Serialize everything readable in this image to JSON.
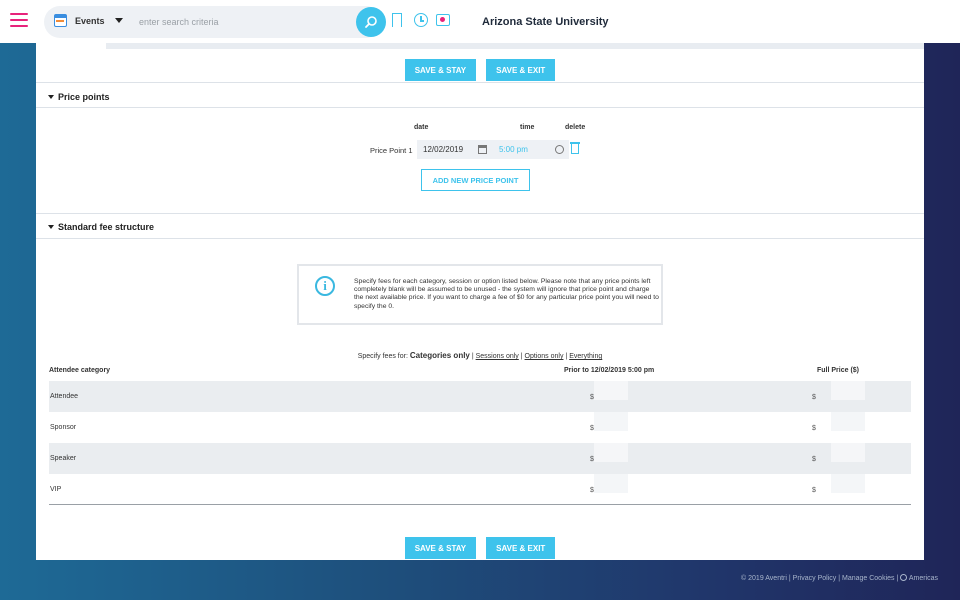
{
  "topbar": {
    "category": "Events",
    "search_placeholder": "enter search criteria",
    "org_name": "Arizona State University"
  },
  "actions": {
    "save_stay": "SAVE & STAY",
    "save_exit": "SAVE & EXIT"
  },
  "price_points": {
    "title": "Price points",
    "col_date": "date",
    "col_time": "time",
    "col_delete": "delete",
    "rows": [
      {
        "label": "Price Point 1",
        "date": "12/02/2019",
        "time": "5:00 pm"
      }
    ],
    "add_button": "ADD NEW PRICE POINT"
  },
  "fees": {
    "title": "Standard fee structure",
    "info": "Specify fees for each category, session or option listed below. Please note that any price points left completely blank will be assumed to be unused - the system will ignore that price point and charge the next available price. If you want to charge a fee of $0 for any particular price point you will need to specify the 0.",
    "specify_prefix": "Specify fees for:",
    "opt_categories": "Categories only",
    "opt_sessions": "Sessions only",
    "opt_options": "Options only",
    "opt_everything": "Everything",
    "sep": "|",
    "columns": {
      "category": "Attendee category",
      "prior": "Prior to 12/02/2019 5:00 pm",
      "full": "Full Price ($)"
    },
    "currency": "$",
    "rows": [
      {
        "label": "Attendee"
      },
      {
        "label": "Sponsor"
      },
      {
        "label": "Speaker"
      },
      {
        "label": "VIP"
      }
    ]
  },
  "footer": {
    "copyright": "© 2019 Aventri",
    "privacy": "Privacy Policy",
    "cookies": "Manage Cookies",
    "region": "Americas",
    "sep": "|"
  },
  "colors": {
    "accent": "#3ec3ec",
    "brand": "#e8237b"
  }
}
